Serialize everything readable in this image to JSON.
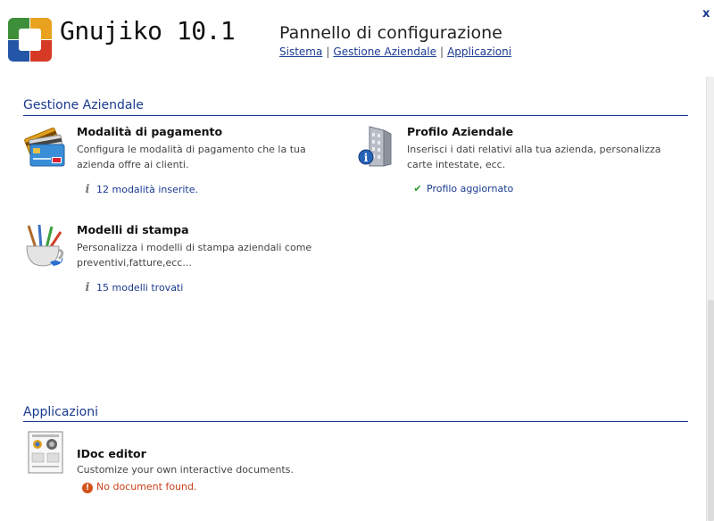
{
  "header": {
    "app_title": "Gnujiko 10.1",
    "page_title": "Pannello di configurazione",
    "breadcrumb": [
      "Sistema",
      "Gestione Aziendale",
      "Applicazioni"
    ],
    "close_label": "x"
  },
  "sections": {
    "gestione": {
      "title": "Gestione Aziendale",
      "items": [
        {
          "title": "Modalità di pagamento",
          "description": "Configura le modalità di pagamento che la tua azienda offre ai clienti.",
          "status": "12 modalità inserite.",
          "icon": "credit-cards-icon"
        },
        {
          "title": "Profilo Aziendale",
          "description": "Inserisci i dati relativi alla tua azienda, personalizza carte intestate, ecc.",
          "status": "Profilo aggiornato",
          "icon": "building-info-icon"
        },
        {
          "title": "Modelli di stampa",
          "description": "Personalizza i modelli di stampa aziendali come preventivi,fatture,ecc...",
          "status": "15 modelli trovati",
          "icon": "paint-brushes-cup-icon"
        }
      ]
    },
    "applicazioni": {
      "title": "Applicazioni",
      "items": [
        {
          "title": "IDoc editor",
          "description": "Customize your own interactive documents.",
          "status": "No document found.",
          "icon": "printer-test-page-icon"
        }
      ]
    }
  },
  "colors": {
    "accent": "#1a3a8f",
    "error": "#c94018",
    "success": "#2a9a2a"
  }
}
